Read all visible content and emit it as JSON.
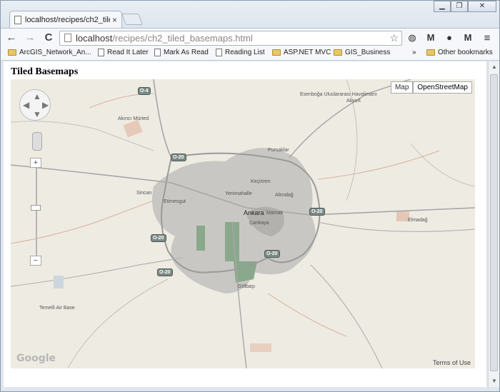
{
  "browser": {
    "tab_title": "localhost/recipes/ch2_tile",
    "tab_close": "×",
    "url_host": "localhost",
    "url_path": "/recipes/ch2_tiled_basemaps.html",
    "window_controls": [
      "▁",
      "❐",
      "✕"
    ]
  },
  "toolbar": {
    "back": "←",
    "forward": "→",
    "reload": "C",
    "star": "☆",
    "menu": "≡",
    "extension_icons": [
      "globe-icon",
      "gmail-icon",
      "pin-icon",
      "gmail-checker-icon"
    ]
  },
  "bookmarks": {
    "items": [
      {
        "label": "ArcGIS_Network_An...",
        "type": "folder"
      },
      {
        "label": "Read It Later",
        "type": "page"
      },
      {
        "label": "Mark As Read",
        "type": "page"
      },
      {
        "label": "Reading List",
        "type": "page"
      },
      {
        "label": "ASP.NET MVC",
        "type": "folder"
      },
      {
        "label": "GIS_Business",
        "type": "folder"
      }
    ],
    "overflow": "»",
    "other": "Other bookmarks"
  },
  "page": {
    "heading": "Tiled Basemaps"
  },
  "map": {
    "map_types": [
      "Map",
      "OpenStreetMap"
    ],
    "selected_map_type": "OpenStreetMap",
    "zoom_in": "+",
    "zoom_out": "−",
    "watermark": "Google",
    "terms": "Terms of Use",
    "labels": {
      "ankara": "Ankara",
      "mamak": "Mamak",
      "cankaya": "Çankaya",
      "kecioren": "Keçiören",
      "yenimahalle": "Yenimahalle",
      "altindag": "Altındağ",
      "sincan": "Sincan",
      "etimesgut": "Etimesgut",
      "pursaklar": "Pursaklar",
      "golbasi": "Gölbaşı",
      "elmadag": "Elmadağ",
      "akyurt": "Akyurt",
      "esenboga": "Esenboğa Uluslararası Havalimanı",
      "temelli": "Temelli Air Base",
      "akinci": "Akıncı Mürted"
    },
    "roads": [
      "O-4",
      "O-20",
      "O-20",
      "O-20",
      "O-20",
      "O-20"
    ]
  }
}
